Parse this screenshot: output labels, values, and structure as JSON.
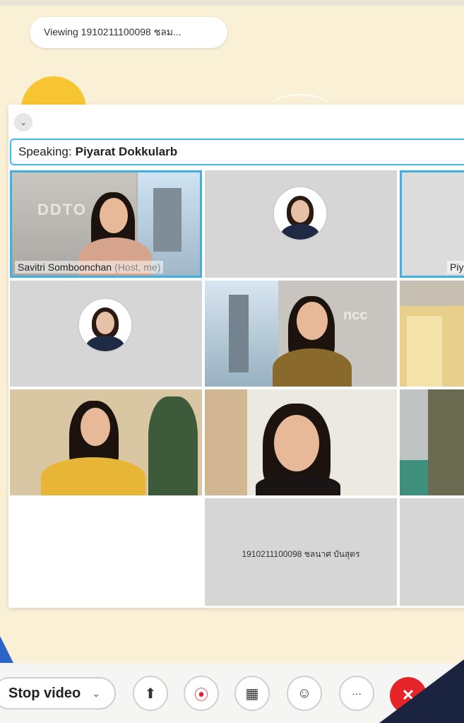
{
  "viewing": "Viewing 1910211100098 ชลม...",
  "speaking": {
    "prefix": "Speaking:",
    "name": "Piyarat Dokkularb"
  },
  "tiles": {
    "t1": {
      "name": "Savitri Somboonchan",
      "suffix": "(Host, me)",
      "wall_text": "DDTO"
    },
    "t3": {
      "name": "Piy"
    },
    "t5": {
      "wall_text": "ncc"
    },
    "placeholder": {
      "name": "1910211100098 ชลนาศ บันสุตร"
    }
  },
  "toolbar": {
    "stop_video": "Stop video",
    "chevron": "⌄",
    "share": "⬆",
    "record": "⦿",
    "layout": "▦",
    "reactions": "☺",
    "more": "···",
    "end": "✕"
  },
  "icons": {
    "collapse": "⌄"
  },
  "colors": {
    "accent": "#3fb0e0",
    "end_call": "#e5252a",
    "background": "#faf0d6"
  }
}
